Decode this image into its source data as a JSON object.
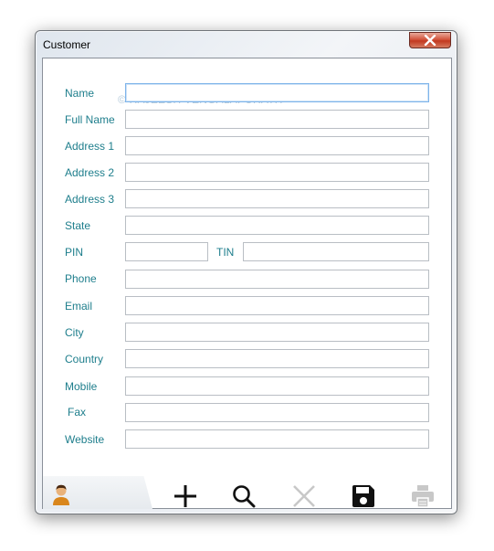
{
  "window": {
    "title": "Customer"
  },
  "watermark": "© RAJEESH VENGALAPURATH",
  "fields": [
    {
      "label": "Name",
      "value": ""
    },
    {
      "label": "Full Name",
      "value": ""
    },
    {
      "label": "Address 1",
      "value": ""
    },
    {
      "label": "Address 2",
      "value": ""
    },
    {
      "label": "Address 3",
      "value": ""
    },
    {
      "label": "State",
      "value": ""
    },
    {
      "label": "PIN",
      "value": ""
    },
    {
      "label": "TIN",
      "value": ""
    },
    {
      "label": "Phone",
      "value": ""
    },
    {
      "label": "Email",
      "value": ""
    },
    {
      "label": "City",
      "value": ""
    },
    {
      "label": "Country",
      "value": ""
    },
    {
      "label": "Mobile",
      "value": ""
    },
    {
      "label": "Fax",
      "value": ""
    },
    {
      "label": "Website",
      "value": ""
    }
  ],
  "toolbar": {
    "icons": [
      "user-icon",
      "add-icon",
      "search-icon",
      "delete-icon",
      "save-icon",
      "print-icon"
    ],
    "colors": {
      "active": "#111111",
      "disabled": "#c8c8c8",
      "label": "#1e7e8c"
    }
  }
}
